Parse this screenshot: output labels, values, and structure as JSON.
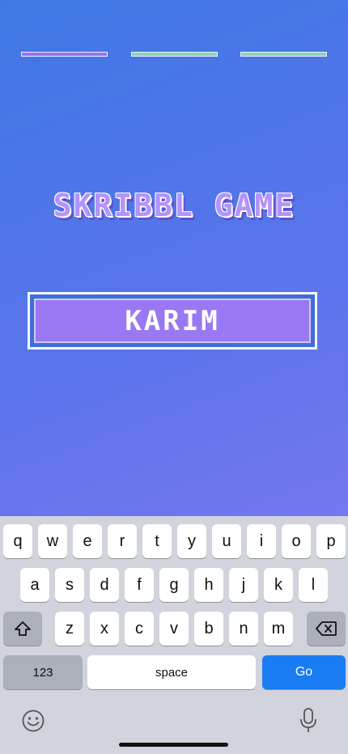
{
  "progress": {
    "segments": [
      "purple",
      "green",
      "green"
    ]
  },
  "title": "SKRIBBL GAME",
  "name_field": {
    "value": "KARIM"
  },
  "keyboard": {
    "row1": [
      "q",
      "w",
      "e",
      "r",
      "t",
      "y",
      "u",
      "i",
      "o",
      "p"
    ],
    "row2": [
      "a",
      "s",
      "d",
      "f",
      "g",
      "h",
      "j",
      "k",
      "l"
    ],
    "row3": [
      "z",
      "x",
      "c",
      "v",
      "b",
      "n",
      "m"
    ],
    "numbers_label": "123",
    "space_label": "space",
    "go_label": "Go",
    "shift_icon": "shift-icon",
    "delete_icon": "backspace-icon",
    "emoji_icon": "emoji-icon",
    "mic_icon": "microphone-icon"
  },
  "colors": {
    "bg_top": "#3f78e4",
    "bg_bottom": "#8f7bf2",
    "segment_purple": "#9b73f0",
    "segment_green": "#8fd3b7",
    "go_button": "#1a7cf3"
  }
}
